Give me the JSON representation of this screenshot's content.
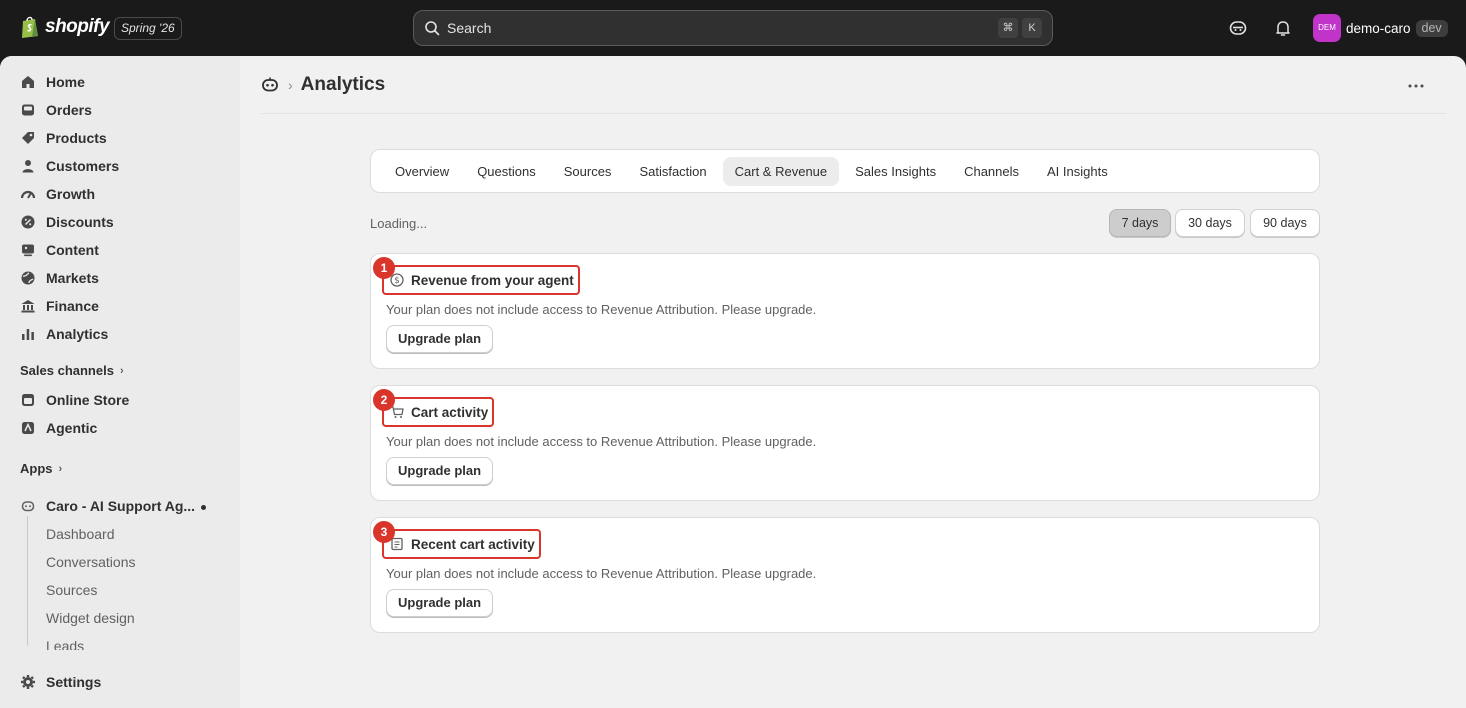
{
  "topbar": {
    "brand": "shopify",
    "edition": "Spring '26",
    "search": {
      "placeholder": "Search",
      "shortcut_keys": [
        "⌘",
        "K"
      ]
    },
    "store": {
      "avatar_text": "DEM",
      "name": "demo-caro",
      "badge": "dev",
      "avatar_color": "#c134c9"
    }
  },
  "sidebar": {
    "items": [
      {
        "label": "Home",
        "icon": "home-icon"
      },
      {
        "label": "Orders",
        "icon": "orders-icon"
      },
      {
        "label": "Products",
        "icon": "tag-icon"
      },
      {
        "label": "Customers",
        "icon": "person-icon"
      },
      {
        "label": "Growth",
        "icon": "gauge-icon"
      },
      {
        "label": "Discounts",
        "icon": "discount-icon"
      },
      {
        "label": "Content",
        "icon": "content-icon"
      },
      {
        "label": "Markets",
        "icon": "globe-icon"
      },
      {
        "label": "Finance",
        "icon": "bank-icon"
      },
      {
        "label": "Analytics",
        "icon": "bar-chart-icon"
      }
    ],
    "sales_channels_label": "Sales channels",
    "channels": [
      {
        "label": "Online Store",
        "icon": "store-icon"
      },
      {
        "label": "Agentic",
        "icon": "agentic-icon"
      }
    ],
    "apps_label": "Apps",
    "app": {
      "label": "Caro - AI Support Ag...",
      "icon": "robot-icon",
      "sub_items": [
        "Dashboard",
        "Conversations",
        "Sources",
        "Widget design",
        "Leads"
      ]
    },
    "settings_label": "Settings"
  },
  "main": {
    "page_title": "Analytics",
    "tabs": [
      "Overview",
      "Questions",
      "Sources",
      "Satisfaction",
      "Cart & Revenue",
      "Sales Insights",
      "Channels",
      "AI Insights"
    ],
    "active_tab": "Cart & Revenue",
    "loading_text": "Loading...",
    "ranges": [
      "7 days",
      "30 days",
      "90 days"
    ],
    "active_range": "7 days",
    "cards": [
      {
        "badge": "1",
        "title": "Revenue from your agent",
        "icon": "dollar-circle-icon",
        "message": "Your plan does not include access to Revenue Attribution. Please upgrade.",
        "button": "Upgrade plan"
      },
      {
        "badge": "2",
        "title": "Cart activity",
        "icon": "cart-icon",
        "message": "Your plan does not include access to Revenue Attribution. Please upgrade.",
        "button": "Upgrade plan"
      },
      {
        "badge": "3",
        "title": "Recent cart activity",
        "icon": "receipt-icon",
        "message": "Your plan does not include access to Revenue Attribution. Please upgrade.",
        "button": "Upgrade plan"
      }
    ]
  },
  "colors": {
    "highlight": "#d9352b",
    "topbar": "#1a1a1a",
    "sidebar": "#ebebeb"
  }
}
